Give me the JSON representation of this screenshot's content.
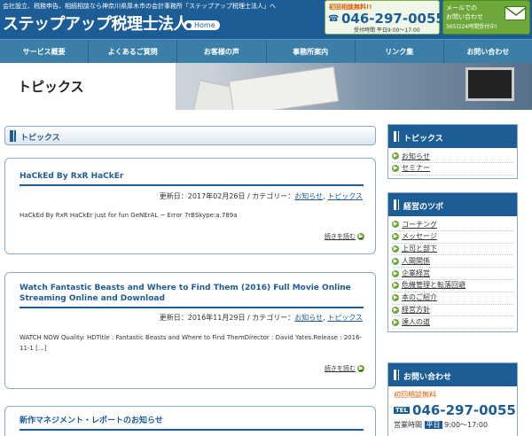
{
  "header": {
    "tagline": "会社設立、税務申告、相続相談なら神奈川県厚木市の会計事務所「ステップアップ税理士法人」へ",
    "site_title": "ステップアップ税理士法人",
    "home_label": "Home",
    "phone": {
      "first_consult": "初回相談無料!!",
      "number": "046-297-0055",
      "hours": "受付時間 平日9:00～17:00"
    },
    "mail": {
      "line1": "メールでの",
      "line2": "お問い合わせ",
      "line3": "365日24時間受付中!"
    }
  },
  "nav": [
    "サービス概要",
    "よくあるご質問",
    "お客様の声",
    "事務所案内",
    "リンク集",
    "お問い合わせ"
  ],
  "banner": {
    "title": "トピックス"
  },
  "main": {
    "section_title": "トピックス",
    "updated_prefix": "更新日：",
    "category_prefix": " / カテゴリー：",
    "read_more": "続きを読む",
    "posts": [
      {
        "title": "HaCkEd By RxR HaCkEr",
        "date": "2017年02月26日",
        "cat1": "お知らせ",
        "cat2": "トピックス",
        "excerpt": "HaCkEd By RxR HaCkEr just for fun GeNErAL ~ Error 7rBSkype:a.789a"
      },
      {
        "title": "Watch Fantastic Beasts and Where to Find Them (2016) Full Movie Online Streaming Online and Download",
        "date": "2016年11月29日",
        "cat1": "お知らせ",
        "cat2": "トピックス",
        "excerpt": "WATCH NOW Quality: HDTitle : Fantastic Beasts and Where to Find ThemDirector : David Yates.Release : 2016-11-1 […]"
      },
      {
        "title": "新作マネジメント・レポートのお知らせ"
      }
    ]
  },
  "sidebar": {
    "topics": {
      "title": "トピックス",
      "items": [
        "お知らせ",
        "セミナー"
      ]
    },
    "tips": {
      "title": "経営のツボ",
      "items": [
        "コーチング",
        "メッセージ",
        "上司と部下",
        "人間関係",
        "企業経営",
        "危機管理と転落回避",
        "本のご紹介",
        "経営方針",
        "達人の道"
      ]
    },
    "contact": {
      "title": "お問い合わせ",
      "first_consult": "初回相談無料",
      "tel_label": "TEL",
      "number": "046-297-0055",
      "hours_prefix": "営業時間",
      "hours_tag": "平日",
      "hours": "9:00～17:00"
    }
  }
}
